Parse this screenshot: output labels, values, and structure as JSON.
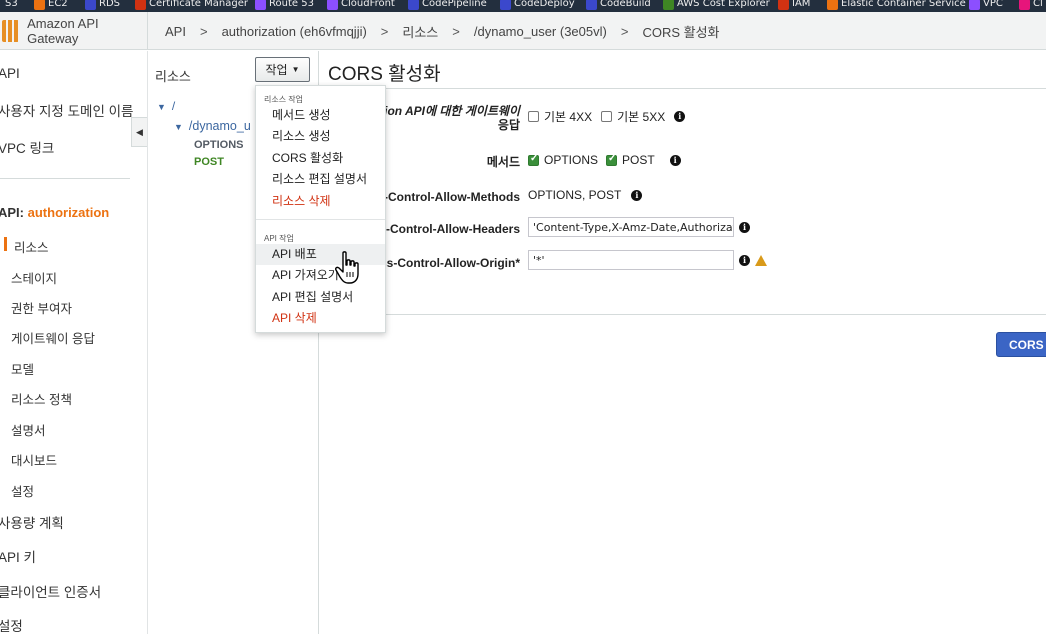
{
  "bookmarks": [
    {
      "label": "S3",
      "color": "#569a31"
    },
    {
      "label": "EC2",
      "color": "#ec7211"
    },
    {
      "label": "RDS",
      "color": "#3b48cc"
    },
    {
      "label": "Certificate Manager",
      "color": "#d13212"
    },
    {
      "label": "Route 53",
      "color": "#8c4fff"
    },
    {
      "label": "CloudFront",
      "color": "#8c4fff"
    },
    {
      "label": "CodePipeline",
      "color": "#3b48cc"
    },
    {
      "label": "CodeDeploy",
      "color": "#3b48cc"
    },
    {
      "label": "CodeBuild",
      "color": "#3b48cc"
    },
    {
      "label": "AWS Cost Explorer",
      "color": "#3f8624"
    },
    {
      "label": "IAM",
      "color": "#d13212"
    },
    {
      "label": "Elastic Container Service",
      "color": "#ec7211"
    },
    {
      "label": "VPC",
      "color": "#8c4fff"
    },
    {
      "label": "Cl",
      "color": "#e7157b"
    }
  ],
  "header": {
    "brand": "Amazon API Gateway",
    "breadcrumb": [
      "API",
      "authorization (eh6vfmqjji)",
      "리소스",
      "/dynamo_user (3e05vl)",
      "CORS 활성화"
    ]
  },
  "leftnav": {
    "top_items": [
      "API",
      "사용자 지정 도메인 이름",
      "VPC 링크"
    ],
    "api_prefix": "API:",
    "api_name": "authorization",
    "sub_items": [
      "리소스",
      "스테이지",
      "권한 부여자",
      "게이트웨이 응답",
      "모델",
      "리소스 정책",
      "설명서",
      "대시보드",
      "설정"
    ],
    "bottom_items": [
      "사용량 계획",
      "API 키",
      "클라이언트 인증서",
      "설정"
    ]
  },
  "resources": {
    "title": "리소스",
    "actions_label": "작업",
    "tree_root": "/",
    "tree_child": "/dynamo_u",
    "methods": [
      {
        "label": "OPTIONS",
        "color": "#545b64"
      },
      {
        "label": "POST",
        "color": "#3f8624"
      }
    ]
  },
  "dropdown": {
    "group1_label": "리소스 작업",
    "group1_items": [
      {
        "label": "메서드 생성",
        "danger": false
      },
      {
        "label": "리소스 생성",
        "danger": false
      },
      {
        "label": "CORS 활성화",
        "danger": false
      },
      {
        "label": "리소스 편집 설명서",
        "danger": false
      },
      {
        "label": "리소스 삭제",
        "danger": true
      }
    ],
    "group2_label": "API 작업",
    "group2_items": [
      {
        "label": "API 배포",
        "danger": false
      },
      {
        "label": "API 가져오기",
        "danger": false
      },
      {
        "label": "API 편집 설명서",
        "danger": false
      },
      {
        "label": "API 삭제",
        "danger": true
      }
    ]
  },
  "main": {
    "title": "CORS 활성화",
    "gateway_label_1": "ation API에 대한 게이트웨이",
    "gateway_label_2": "응답",
    "gateway_4xx": "기본 4XX",
    "gateway_5xx": "기본 5XX",
    "methods_label": "메서드",
    "method_options": "OPTIONS",
    "method_post": "POST",
    "allow_methods_label": "-Control-Allow-Methods",
    "allow_methods_value": "OPTIONS, POST",
    "allow_headers_label": "s-Control-Allow-Headers",
    "allow_headers_value": "'Content-Type,X-Amz-Date,Authorization",
    "allow_origin_label": "ss-Control-Allow-Origin*",
    "allow_origin_value": "'*'",
    "cors_button": "CORS"
  }
}
